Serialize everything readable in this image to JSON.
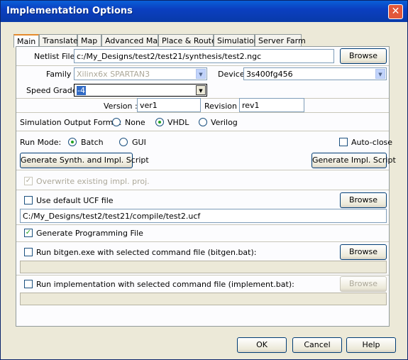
{
  "window": {
    "title": "Implementation Options",
    "close_label": "✕"
  },
  "tabs": [
    "Main",
    "Translate",
    "Map",
    "Advanced Map",
    "Place & Route",
    "Simulation",
    "Server Farm"
  ],
  "netlist": {
    "label": "Netlist File",
    "value": "c:/My_Designs/test2/test21/synthesis/test2.ngc",
    "browse": "Browse"
  },
  "family": {
    "label": "Family",
    "value": "Xilinx6x SPARTAN3"
  },
  "device": {
    "label": "Device",
    "value": "3s400fg456"
  },
  "speed": {
    "label": "Speed Grade",
    "value": "-4"
  },
  "version": {
    "label": "Version :",
    "value": "ver1"
  },
  "revision": {
    "label": "Revision :",
    "value": "rev1"
  },
  "sim_format": {
    "label": "Simulation Output Format",
    "options": [
      "None",
      "VHDL",
      "Verilog"
    ],
    "selected": "VHDL"
  },
  "run_mode": {
    "label": "Run Mode:",
    "options": [
      "Batch",
      "GUI"
    ],
    "selected": "Batch",
    "auto_close": "Auto-close"
  },
  "scripts": {
    "synth_impl": "Generate Synth. and Impl. Script",
    "impl": "Generate Impl. Script"
  },
  "overwrite": {
    "label": "Overwrite existing impl. proj.",
    "checked": true
  },
  "ucf": {
    "label": "Use default UCF file",
    "checked": false,
    "browse": "Browse",
    "path": "C:/My_Designs/test2/test21/compile/test2.ucf"
  },
  "gen_prog": {
    "label": "Generate Programming File",
    "checked": true
  },
  "bitgen": {
    "label": "Run bitgen.exe with selected command file (bitgen.bat):",
    "checked": false,
    "browse": "Browse"
  },
  "implement": {
    "label": "Run implementation with selected command file (implement.bat):",
    "checked": false,
    "browse": "Browse"
  },
  "footer": {
    "ok": "OK",
    "cancel": "Cancel",
    "help": "Help"
  },
  "colors": {
    "title_bar": "#0b4fd0",
    "accent_check": "#21a121",
    "dialog_bg": "#ece9d8"
  }
}
